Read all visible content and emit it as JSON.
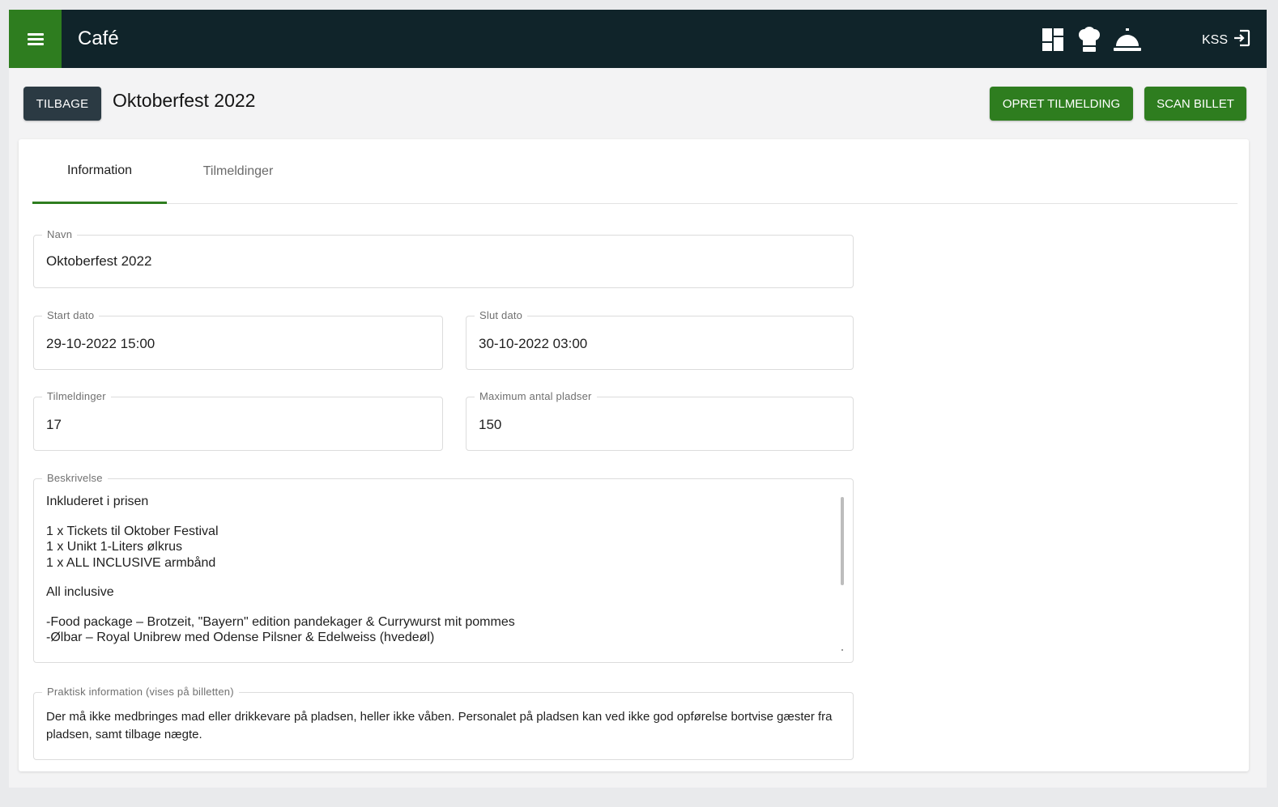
{
  "topbar": {
    "title": "Café",
    "icons": [
      "dashboard-icon",
      "chef-hat-icon",
      "service-bell-icon"
    ],
    "user_label": "KSS",
    "logout_icon": "logout-icon",
    "colors": {
      "bar": "#10242a",
      "menu": "#2e7d1f"
    }
  },
  "header": {
    "back_label": "TILBAGE",
    "page_title": "Oktoberfest 2022",
    "create_label": "OPRET TILMELDING",
    "scan_label": "SCAN BILLET"
  },
  "tabs": [
    {
      "label": "Information",
      "active": true
    },
    {
      "label": "Tilmeldinger",
      "active": false
    }
  ],
  "form": {
    "navn": {
      "label": "Navn",
      "value": "Oktoberfest 2022"
    },
    "start": {
      "label": "Start dato",
      "value": "29-10-2022 15:00"
    },
    "slut": {
      "label": "Slut dato",
      "value": "30-10-2022 03:00"
    },
    "tilmeldinger": {
      "label": "Tilmeldinger",
      "value": "17"
    },
    "max": {
      "label": "Maximum antal pladser",
      "value": "150"
    },
    "beskrivelse": {
      "label": "Beskrivelse",
      "lines": [
        "Inkluderet i prisen",
        "",
        "1 x Tickets til Oktober Festival",
        "1 x Unikt 1-Liters ølkrus",
        "1 x ALL INCLUSIVE armbånd",
        "",
        "All inclusive",
        "",
        "-Food package – Brotzeit, \"Bayern\" edition pandekager & Currywurst mit pommes",
        "-Ølbar – Royal Unibrew med Odense Pilsner & Edelweiss (hvedeøl)"
      ]
    },
    "praktisk": {
      "label": "Praktisk information (vises på billetten)",
      "value": "Der må ikke medbringes mad eller drikkevare på pladsen, heller ikke våben. Personalet på pladsen kan ved ikke god opførelse bortvise gæster fra pladsen, samt tilbage nægte."
    }
  },
  "colors": {
    "accent": "#2e7d1f",
    "back_button": "#2b3a43"
  }
}
